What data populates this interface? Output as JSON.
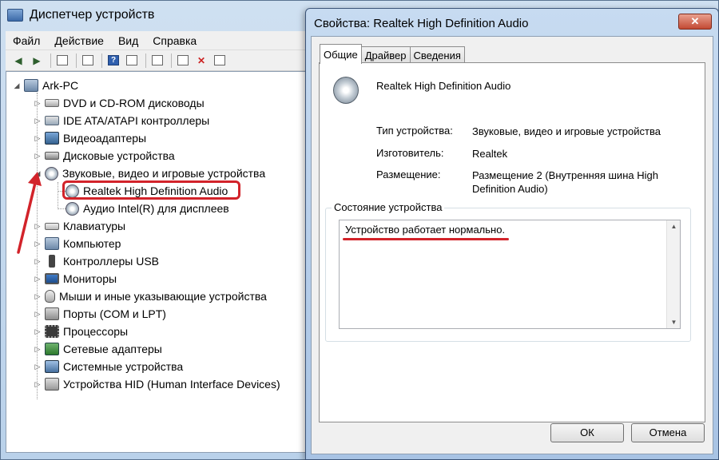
{
  "device_manager": {
    "title": "Диспетчер устройств",
    "menu": [
      "Файл",
      "Действие",
      "Вид",
      "Справка"
    ],
    "tree": {
      "root": "Ark-PC",
      "items": [
        {
          "label": "DVD и CD-ROM дисководы",
          "icon": "dvd-drive-icon",
          "expanded": false
        },
        {
          "label": "IDE ATA/ATAPI контроллеры",
          "icon": "ide-controller-icon",
          "expanded": false
        },
        {
          "label": "Видеоадаптеры",
          "icon": "video-adapter-icon",
          "expanded": false
        },
        {
          "label": "Дисковые устройства",
          "icon": "disk-drive-icon",
          "expanded": false
        },
        {
          "label": "Звуковые, видео и игровые устройства",
          "icon": "sound-device-icon",
          "expanded": true
        },
        {
          "label": "Клавиатуры",
          "icon": "keyboard-icon",
          "expanded": false
        },
        {
          "label": "Компьютер",
          "icon": "computer-icon",
          "expanded": false
        },
        {
          "label": "Контроллеры USB",
          "icon": "usb-icon",
          "expanded": false
        },
        {
          "label": "Мониторы",
          "icon": "monitor-icon",
          "expanded": false
        },
        {
          "label": "Мыши и иные указывающие устройства",
          "icon": "mouse-icon",
          "expanded": false
        },
        {
          "label": "Порты (COM и LPT)",
          "icon": "port-icon",
          "expanded": false
        },
        {
          "label": "Процессоры",
          "icon": "cpu-icon",
          "expanded": false
        },
        {
          "label": "Сетевые адаптеры",
          "icon": "network-adapter-icon",
          "expanded": false
        },
        {
          "label": "Системные устройства",
          "icon": "system-device-icon",
          "expanded": false
        },
        {
          "label": "Устройства HID (Human Interface Devices)",
          "icon": "hid-device-icon",
          "expanded": false
        }
      ],
      "sound_children": [
        "Realtek High Definition Audio",
        "Аудио Intel(R) для дисплеев"
      ]
    },
    "highlight_color": "#d2232a"
  },
  "properties_dialog": {
    "title": "Свойства: Realtek High Definition Audio",
    "close_label": "✕",
    "tabs": [
      "Общие",
      "Драйвер",
      "Сведения"
    ],
    "device_name": "Realtek High Definition Audio",
    "props": {
      "type_label": "Тип устройства:",
      "type_value": "Звуковые, видео и игровые устройства",
      "maker_label": "Изготовитель:",
      "maker_value": "Realtek",
      "location_label": "Размещение:",
      "location_value": "Размещение 2 (Внутренняя шина High Definition Audio)"
    },
    "status_caption": "Состояние устройства",
    "status_text": "Устройство работает нормально.",
    "ok_label": "ОК",
    "cancel_label": "Отмена"
  }
}
